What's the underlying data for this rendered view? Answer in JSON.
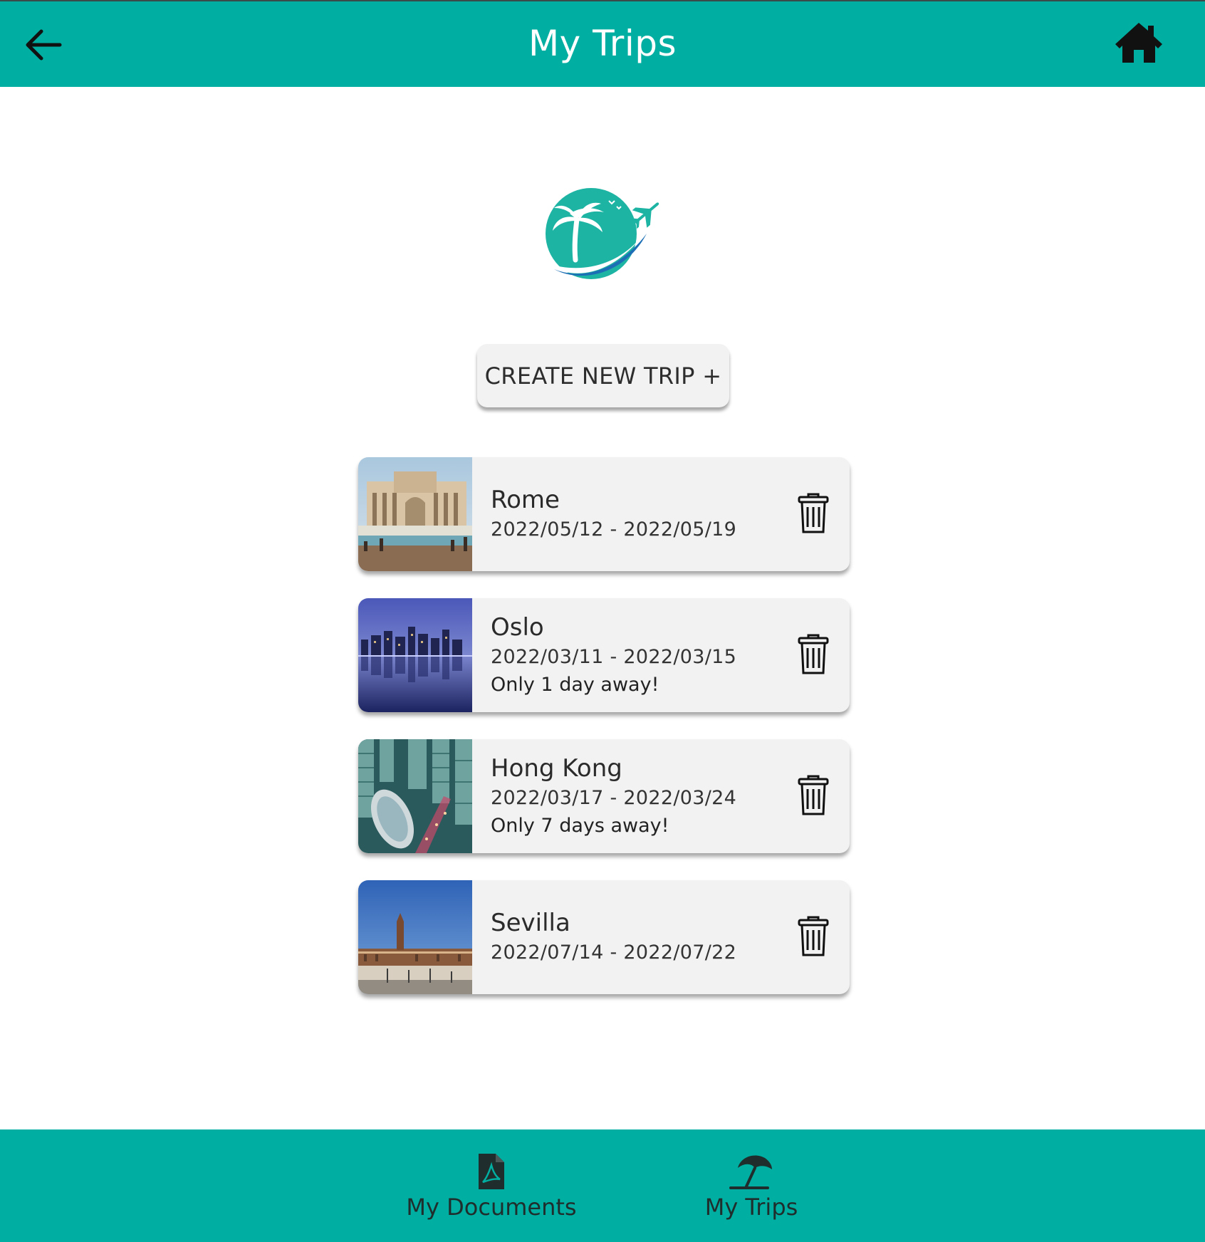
{
  "header": {
    "title": "My Trips",
    "back_icon": "arrow-left-icon",
    "home_icon": "home-icon"
  },
  "colors": {
    "brand": "#00afa1",
    "card": "#f2f2f2",
    "logo_teal": "#1db4a4",
    "logo_blue": "#1d6fb5"
  },
  "create_button": {
    "label": "CREATE NEW TRIP +"
  },
  "trips": [
    {
      "name": "Rome",
      "dates": "2022/05/12 - 2022/05/19",
      "away": ""
    },
    {
      "name": "Oslo",
      "dates": "2022/03/11 - 2022/03/15",
      "away": "Only 1 day away!"
    },
    {
      "name": "Hong Kong",
      "dates": "2022/03/17 - 2022/03/24",
      "away": "Only 7 days away!"
    },
    {
      "name": "Sevilla",
      "dates": "2022/07/14 - 2022/07/22",
      "away": ""
    }
  ],
  "bottom_nav": {
    "documents_label": "My Documents",
    "documents_icon": "pdf-file-icon",
    "trips_label": "My Trips",
    "trips_icon": "beach-umbrella-icon"
  }
}
